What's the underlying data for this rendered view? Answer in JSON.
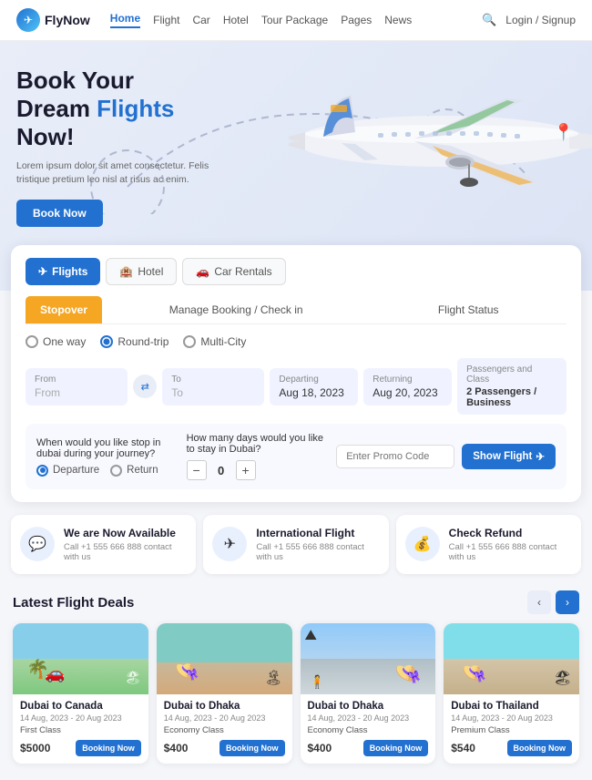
{
  "header": {
    "logo_text": "FlyNow",
    "nav_items": [
      "Home",
      "Flight",
      "Car",
      "Hotel",
      "Tour Package",
      "Pages",
      "News"
    ],
    "active_nav": "Home",
    "login_label": "Login / Signup"
  },
  "hero": {
    "headline_1": "Book Your",
    "headline_2": "Dream ",
    "headline_highlight": "Flights",
    "headline_3": "Now!",
    "description": "Lorem ipsum dolor sit amet consectetur. Felis tristique pretium leo nisl at risus ac enim.",
    "cta_label": "Book Now"
  },
  "booking": {
    "tabs": [
      {
        "label": "Flights",
        "active": true
      },
      {
        "label": "Hotel",
        "active": false
      },
      {
        "label": "Car Rentals",
        "active": false
      }
    ],
    "sub_tabs": [
      {
        "label": "Stopover",
        "active": true
      },
      {
        "label": "Manage Booking / Check in",
        "active": false
      },
      {
        "label": "Flight Status",
        "active": false
      }
    ],
    "trip_types": [
      "One way",
      "Round-trip",
      "Multi-City"
    ],
    "from_label": "From",
    "from_placeholder": "From",
    "to_label": "To",
    "to_placeholder": "To",
    "departing_label": "Departing",
    "departing_value": "Aug 18, 2023",
    "returning_label": "Returning",
    "returning_value": "Aug 20, 2023",
    "passengers_label": "Passengers and Class",
    "passengers_value": "2 Passengers / Business",
    "stopover_question": "When would you like stop in dubai during your journey?",
    "departure_label": "Departure",
    "return_label": "Return",
    "days_question": "How many days would you like to stay in Dubai?",
    "counter_value": "0",
    "promo_placeholder": "Enter Promo Code",
    "show_flight_label": "Show Flight"
  },
  "features": [
    {
      "icon": "💬",
      "title": "We are Now Available",
      "sub": "Call +1 555 666 888 contact with us"
    },
    {
      "icon": "✈",
      "title": "International Flight",
      "sub": "Call +1 555 666 888 contact with us"
    },
    {
      "icon": "💰",
      "title": "Check Refund",
      "sub": "Call +1 555 666 888 contact with us"
    }
  ],
  "deals": {
    "section_title": "Latest Flight Deals",
    "cards": [
      {
        "route": "Dubai to Canada",
        "date": "14 Aug, 2023 - 20 Aug 2023",
        "class": "First Class",
        "price": "$5000",
        "color1": "#4fc3f7",
        "color2": "#81c784",
        "booking_label": "Booking Now"
      },
      {
        "route": "Dubai to Dhaka",
        "date": "14 Aug, 2023 - 20 Aug 2023",
        "class": "Economy Class",
        "price": "$400",
        "color1": "#80cbc4",
        "color2": "#a5d6a7",
        "booking_label": "Booking Now"
      },
      {
        "route": "Dubai to Dhaka",
        "date": "14 Aug, 2023 - 20 Aug 2023",
        "class": "Economy Class",
        "price": "$400",
        "color1": "#90caf9",
        "color2": "#ce93d8",
        "booking_label": "Booking Now"
      },
      {
        "route": "Dubai to Thailand",
        "date": "14 Aug, 2023 - 20 Aug 2023",
        "class": "Premium Class",
        "price": "$540",
        "color1": "#80deea",
        "color2": "#ffcc80",
        "booking_label": "Booking Now"
      }
    ]
  }
}
